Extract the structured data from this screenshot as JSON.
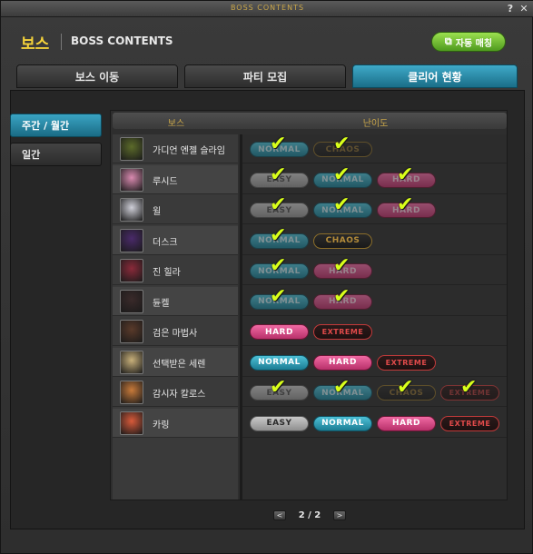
{
  "window": {
    "caption": "BOSS CONTENTS",
    "help_label": "?",
    "close_label": "✕"
  },
  "header": {
    "title_ko": "보스",
    "title_en": "BOSS CONTENTS",
    "auto_match_label": "자동 매칭",
    "auto_match_icon": "link-icon"
  },
  "tabs": [
    {
      "label": "보스 이동",
      "active": false
    },
    {
      "label": "파티 모집",
      "active": false
    },
    {
      "label": "클리어 현황",
      "active": true
    }
  ],
  "side_tabs": [
    {
      "label": "주간 / 월간",
      "active": true
    },
    {
      "label": "일간",
      "active": false
    }
  ],
  "table": {
    "header_boss": "보스",
    "header_difficulty": "난이도"
  },
  "bosses": [
    {
      "name": "가디언 엔젤 슬라임",
      "avatar_color": "#5c6b2a",
      "difficulties": [
        {
          "label": "NORMAL",
          "type": "normal",
          "cleared": true
        },
        {
          "label": "CHAOS",
          "type": "chaos",
          "cleared": true
        }
      ]
    },
    {
      "name": "루시드",
      "avatar_color": "#d98ab0",
      "difficulties": [
        {
          "label": "EASY",
          "type": "easy",
          "cleared": true
        },
        {
          "label": "NORMAL",
          "type": "normal",
          "cleared": true
        },
        {
          "label": "HARD",
          "type": "hard",
          "cleared": true
        }
      ]
    },
    {
      "name": "윌",
      "avatar_color": "#cfcfd8",
      "difficulties": [
        {
          "label": "EASY",
          "type": "easy",
          "cleared": true
        },
        {
          "label": "NORMAL",
          "type": "normal",
          "cleared": true
        },
        {
          "label": "HARD",
          "type": "hard",
          "cleared": true
        }
      ]
    },
    {
      "name": "더스크",
      "avatar_color": "#4a2a6a",
      "difficulties": [
        {
          "label": "NORMAL",
          "type": "normal",
          "cleared": true
        },
        {
          "label": "CHAOS",
          "type": "chaos",
          "cleared": false
        }
      ]
    },
    {
      "name": "진 힐라",
      "avatar_color": "#8a2a3a",
      "difficulties": [
        {
          "label": "NORMAL",
          "type": "normal",
          "cleared": true
        },
        {
          "label": "HARD",
          "type": "hard",
          "cleared": true
        }
      ]
    },
    {
      "name": "듄켈",
      "avatar_color": "#3a2a2a",
      "difficulties": [
        {
          "label": "NORMAL",
          "type": "normal",
          "cleared": true
        },
        {
          "label": "HARD",
          "type": "hard",
          "cleared": true
        }
      ]
    },
    {
      "name": "검은 마법사",
      "avatar_color": "#5a3a2a",
      "difficulties": [
        {
          "label": "HARD",
          "type": "hard",
          "cleared": false
        },
        {
          "label": "EXTREME",
          "type": "extreme",
          "cleared": false
        }
      ]
    },
    {
      "name": "선택받은 세렌",
      "avatar_color": "#c8b07a",
      "difficulties": [
        {
          "label": "NORMAL",
          "type": "normal",
          "cleared": false
        },
        {
          "label": "HARD",
          "type": "hard",
          "cleared": false
        },
        {
          "label": "EXTREME",
          "type": "extreme",
          "cleared": false
        }
      ]
    },
    {
      "name": "감시자 칼로스",
      "avatar_color": "#c87a3a",
      "difficulties": [
        {
          "label": "EASY",
          "type": "easy",
          "cleared": true
        },
        {
          "label": "NORMAL",
          "type": "normal",
          "cleared": true
        },
        {
          "label": "CHAOS",
          "type": "chaos",
          "cleared": true
        },
        {
          "label": "EXTREME",
          "type": "extreme",
          "cleared": true
        }
      ]
    },
    {
      "name": "카링",
      "avatar_color": "#d85a3a",
      "difficulties": [
        {
          "label": "EASY",
          "type": "easy",
          "cleared": false
        },
        {
          "label": "NORMAL",
          "type": "normal",
          "cleared": false
        },
        {
          "label": "HARD",
          "type": "hard",
          "cleared": false
        },
        {
          "label": "EXTREME",
          "type": "extreme",
          "cleared": false
        }
      ]
    }
  ],
  "pager": {
    "prev_label": "<",
    "text": "2 / 2",
    "next_label": ">"
  }
}
